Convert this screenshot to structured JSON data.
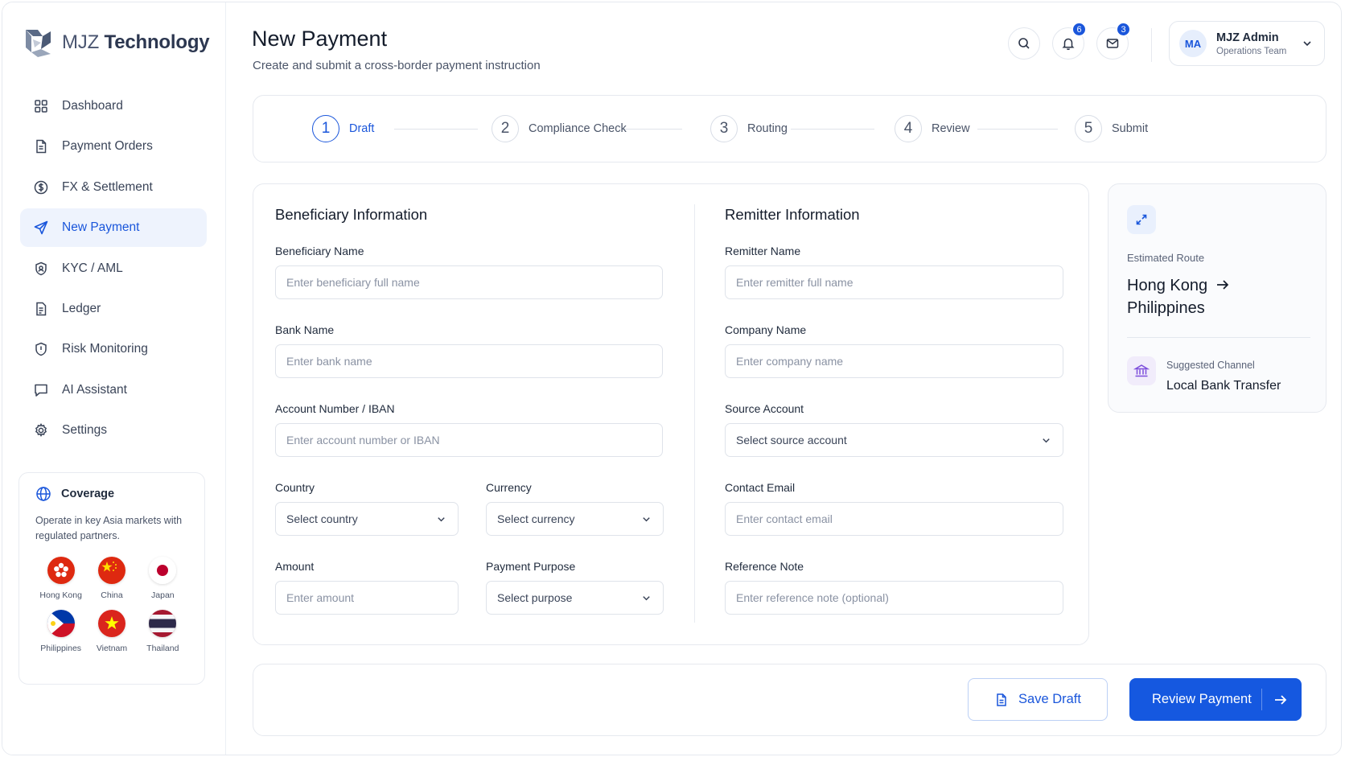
{
  "brand": {
    "prefix": "MJZ",
    "name": "Technology"
  },
  "sidebar": {
    "items": [
      {
        "label": "Dashboard",
        "icon": "grid-icon"
      },
      {
        "label": "Payment Orders",
        "icon": "document-icon"
      },
      {
        "label": "FX & Settlement",
        "icon": "dollar-circle-icon"
      },
      {
        "label": "New Payment",
        "icon": "send-icon",
        "active": true
      },
      {
        "label": "KYC / AML",
        "icon": "shield-icon"
      },
      {
        "label": "Ledger",
        "icon": "ledger-icon"
      },
      {
        "label": "Risk Monitoring",
        "icon": "shield-alert-icon"
      },
      {
        "label": "AI Assistant",
        "icon": "chat-icon"
      },
      {
        "label": "Settings",
        "icon": "gear-icon"
      }
    ],
    "coverage": {
      "title": "Coverage",
      "description": "Operate in key Asia markets with regulated partners.",
      "countries": [
        "Hong Kong",
        "China",
        "Japan",
        "Philippines",
        "Vietnam",
        "Thailand"
      ]
    }
  },
  "header": {
    "title": "New Payment",
    "subtitle": "Create and submit a cross-border payment instruction",
    "notifications_count": "6",
    "messages_count": "3",
    "user": {
      "initials": "MA",
      "name": "MJZ Admin",
      "role": "Operations Team"
    }
  },
  "stepper": {
    "steps": [
      {
        "num": "1",
        "label": "Draft",
        "active": true
      },
      {
        "num": "2",
        "label": "Compliance Check"
      },
      {
        "num": "3",
        "label": "Routing"
      },
      {
        "num": "4",
        "label": "Review"
      },
      {
        "num": "5",
        "label": "Submit"
      }
    ]
  },
  "beneficiary": {
    "title": "Beneficiary Information",
    "name": {
      "label": "Beneficiary Name",
      "placeholder": "Enter beneficiary full name"
    },
    "bank": {
      "label": "Bank Name",
      "placeholder": "Enter bank name"
    },
    "account": {
      "label": "Account Number / IBAN",
      "placeholder": "Enter account number or IBAN"
    },
    "country": {
      "label": "Country",
      "placeholder": "Select country"
    },
    "currency": {
      "label": "Currency",
      "placeholder": "Select currency"
    },
    "amount": {
      "label": "Amount",
      "placeholder": "Enter amount"
    },
    "purpose": {
      "label": "Payment Purpose",
      "placeholder": "Select purpose"
    }
  },
  "remitter": {
    "title": "Remitter Information",
    "name": {
      "label": "Remitter Name",
      "placeholder": "Enter remitter full name"
    },
    "company": {
      "label": "Company Name",
      "placeholder": "Enter company name"
    },
    "source": {
      "label": "Source Account",
      "placeholder": "Select source account"
    },
    "email": {
      "label": "Contact Email",
      "placeholder": "Enter contact email"
    },
    "note": {
      "label": "Reference Note",
      "placeholder": "Enter reference note (optional)"
    }
  },
  "route": {
    "label": "Estimated Route",
    "from": "Hong Kong",
    "to": "Philippines",
    "channel_label": "Suggested Channel",
    "channel_value": "Local Bank Transfer"
  },
  "actions": {
    "save_draft": "Save Draft",
    "review": "Review Payment"
  },
  "colors": {
    "accent": "#1a56db",
    "primary_button": "#1558e0"
  }
}
